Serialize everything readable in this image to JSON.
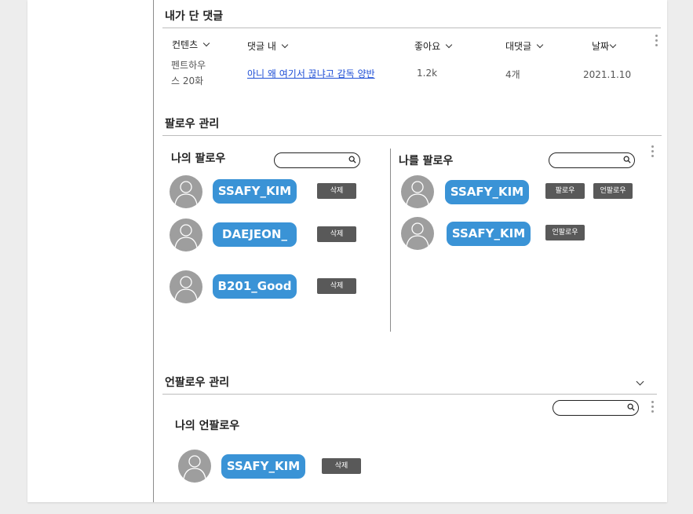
{
  "comments": {
    "title": "내가 단 댓글",
    "columns": [
      "컨텐츠",
      "댓글 내",
      "좋아요",
      "대댓글",
      "날짜"
    ],
    "rows": [
      {
        "content_line1": "펜트하우",
        "content_line2": "스 20화",
        "comment": "아니 왜 여기서 끊냐고 감독 양반",
        "likes": "1.2k",
        "replies": "4개",
        "date": "2021.1.10"
      }
    ]
  },
  "follow": {
    "title": "팔로우 관리",
    "my_following": {
      "title": "나의 팔로우",
      "users": [
        {
          "name": "SSAFY_KIM",
          "action": "삭제"
        },
        {
          "name": "DAEJEON_",
          "action": "삭제"
        },
        {
          "name": "B201_Good",
          "action": "삭제"
        }
      ]
    },
    "followers": {
      "title": "나를 팔로우",
      "users": [
        {
          "name": "SSAFY_KIM",
          "follow_label": "팔로우",
          "unfollow_label": "언팔로우"
        },
        {
          "name": "SSAFY_KIM",
          "unfollow_label": "언팔로우"
        }
      ]
    }
  },
  "unfollow": {
    "title": "언팔로우 관리",
    "my_unfollow": {
      "title": "나의 언팔로우",
      "users": [
        {
          "name": "SSAFY_KIM",
          "action": "삭제"
        }
      ]
    }
  },
  "colors": {
    "pill": "#3a93d6",
    "button": "#595959",
    "link": "#1f4fd6",
    "avatar": "#9e9e9e",
    "background": "#ededed"
  },
  "icons": [
    "search-icon",
    "more-vertical-icon",
    "chevron-down-icon",
    "user-avatar-icon"
  ]
}
